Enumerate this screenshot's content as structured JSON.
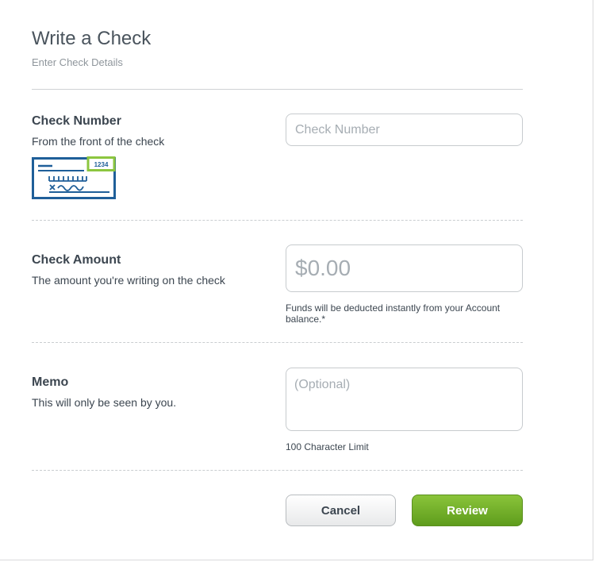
{
  "header": {
    "title": "Write a Check",
    "subtitle": "Enter Check Details"
  },
  "check_number": {
    "label": "Check Number",
    "description": "From the front of the check",
    "placeholder": "Check Number",
    "sample_number": "1234"
  },
  "check_amount": {
    "label": "Check Amount",
    "description": "The amount you're writing on the check",
    "placeholder": "$0.00",
    "note_line1": "Funds will be deducted instantly from your Account",
    "note_line2": "balance.*"
  },
  "memo": {
    "label": "Memo",
    "description": "This will only be seen by you.",
    "placeholder": "(Optional)",
    "limit_note": "100 Character Limit"
  },
  "actions": {
    "cancel_label": "Cancel",
    "review_label": "Review"
  },
  "colors": {
    "check_blue": "#1f5f99",
    "highlight_green": "#8cc63f",
    "review_green": "#6aa826"
  }
}
